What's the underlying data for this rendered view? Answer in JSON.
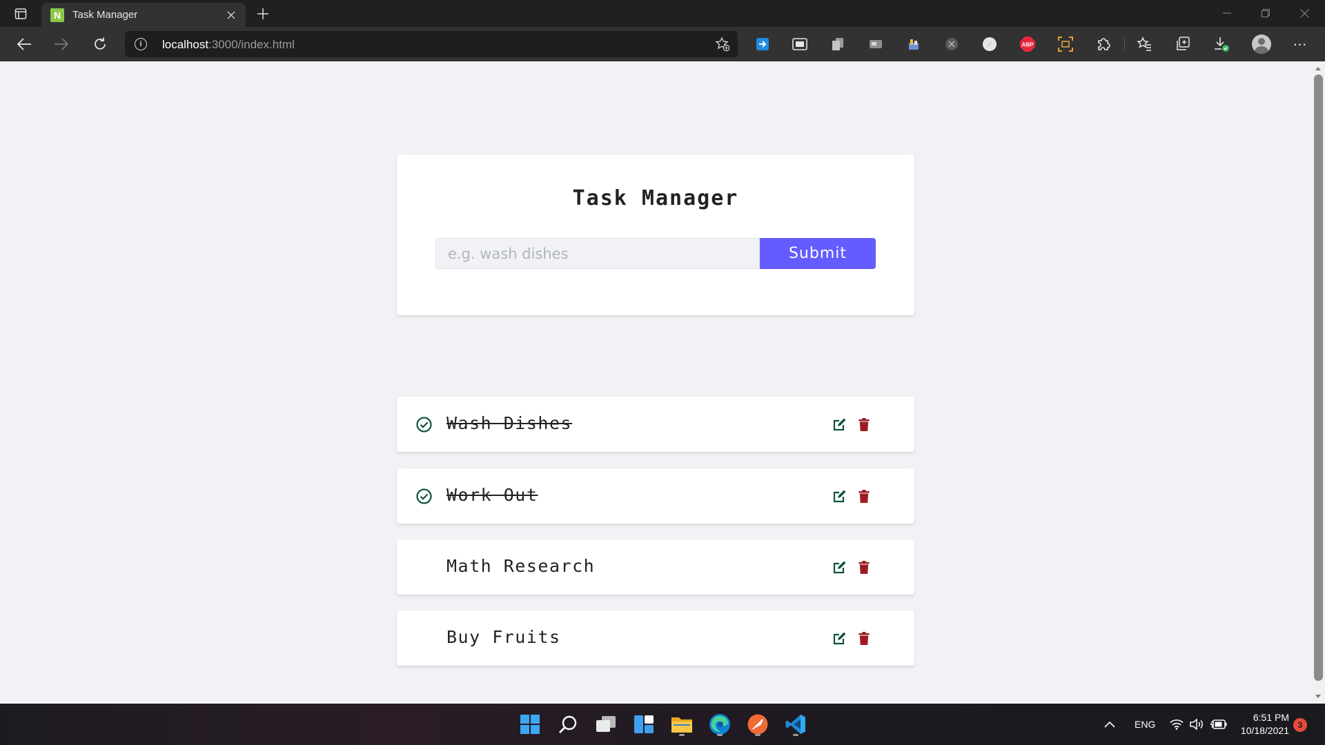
{
  "browser": {
    "tab_title": "Task Manager",
    "tab_favicon_letter": "N",
    "url_host": "localhost",
    "url_rest": ":3000/index.html",
    "extensions": [
      "translate-icon",
      "picture-in-picture-icon",
      "copy-pages-icon",
      "screen-recorder-icon",
      "bookmark-stack-icon",
      "dark-tool-icon",
      "compass-icon",
      "adblock-plus-icon",
      "screen-capture-icon",
      "extensions-puzzle-icon",
      "favorites-icon",
      "collections-icon",
      "downloads-icon"
    ],
    "adblock_label": "ABP"
  },
  "app": {
    "title": "Task Manager",
    "input_placeholder": "e.g. wash dishes",
    "input_value": "",
    "submit_label": "Submit",
    "accent_color": "#645cff",
    "tasks": [
      {
        "name": "Wash Dishes",
        "completed": true
      },
      {
        "name": "Work Out",
        "completed": true
      },
      {
        "name": "Math Research",
        "completed": false
      },
      {
        "name": "Buy Fruits",
        "completed": false
      }
    ]
  },
  "taskbar": {
    "apps": [
      "windows-start-icon",
      "search-icon",
      "task-view-icon",
      "widgets-icon",
      "file-explorer-icon",
      "edge-icon",
      "postman-icon",
      "vscode-icon"
    ],
    "language": "ENG",
    "time": "6:51 PM",
    "date": "10/18/2021",
    "notification_count": "3"
  }
}
